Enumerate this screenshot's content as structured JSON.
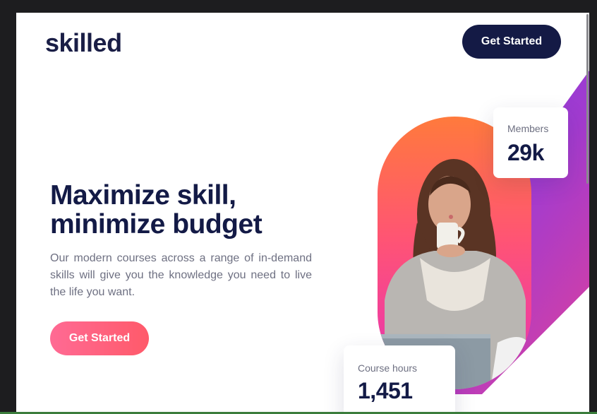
{
  "header": {
    "logo_text": "skilled",
    "cta_label": "Get Started"
  },
  "hero": {
    "title": "Maximize skill, minimize budget",
    "description": "Our modern courses across a range of in-demand skills will give you the knowledge you need to live the life you want.",
    "cta_label": "Get Started"
  },
  "stats": {
    "members": {
      "label": "Members",
      "value": "29k"
    },
    "course_hours": {
      "label": "Course hours",
      "value": "1,451"
    }
  },
  "colors": {
    "navy": "#141a45",
    "cta_gradient_start": "#ff6a94",
    "cta_gradient_end": "#ff5a6a",
    "deco_purple": "#8a3fe0",
    "deco_magenta": "#c03ac0"
  },
  "image": {
    "subject": "woman-drinking-coffee-photo"
  }
}
